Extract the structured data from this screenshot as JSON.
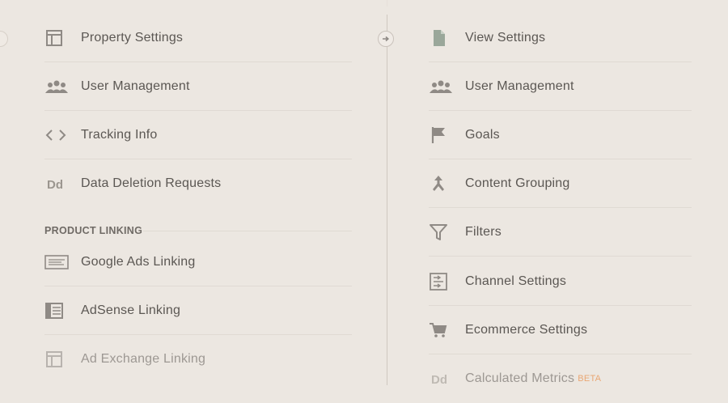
{
  "property": {
    "items": [
      {
        "label": "Property Settings",
        "icon": "layout-icon"
      },
      {
        "label": "User Management",
        "icon": "users-icon"
      },
      {
        "label": "Tracking Info",
        "icon": "code-icon"
      },
      {
        "label": "Data Deletion Requests",
        "icon": "dd-icon"
      }
    ],
    "section_header": "PRODUCT LINKING",
    "linking": [
      {
        "label": "Google Ads Linking",
        "icon": "ads-icon"
      },
      {
        "label": "AdSense Linking",
        "icon": "adsense-icon"
      },
      {
        "label": "Ad Exchange Linking",
        "icon": "layout-icon"
      }
    ]
  },
  "view": {
    "items": [
      {
        "label": "View Settings",
        "icon": "document-icon"
      },
      {
        "label": "User Management",
        "icon": "users-icon"
      },
      {
        "label": "Goals",
        "icon": "flag-icon"
      },
      {
        "label": "Content Grouping",
        "icon": "merge-icon"
      },
      {
        "label": "Filters",
        "icon": "filter-icon"
      },
      {
        "label": "Channel Settings",
        "icon": "channel-icon"
      },
      {
        "label": "Ecommerce Settings",
        "icon": "cart-icon"
      },
      {
        "label": "Calculated Metrics",
        "icon": "dd-icon",
        "badge": "BETA"
      }
    ]
  },
  "colors": {
    "background": "#ece7e1",
    "text": "#5b5753",
    "icon": "#8f8a85",
    "beta": "#e9a774"
  }
}
